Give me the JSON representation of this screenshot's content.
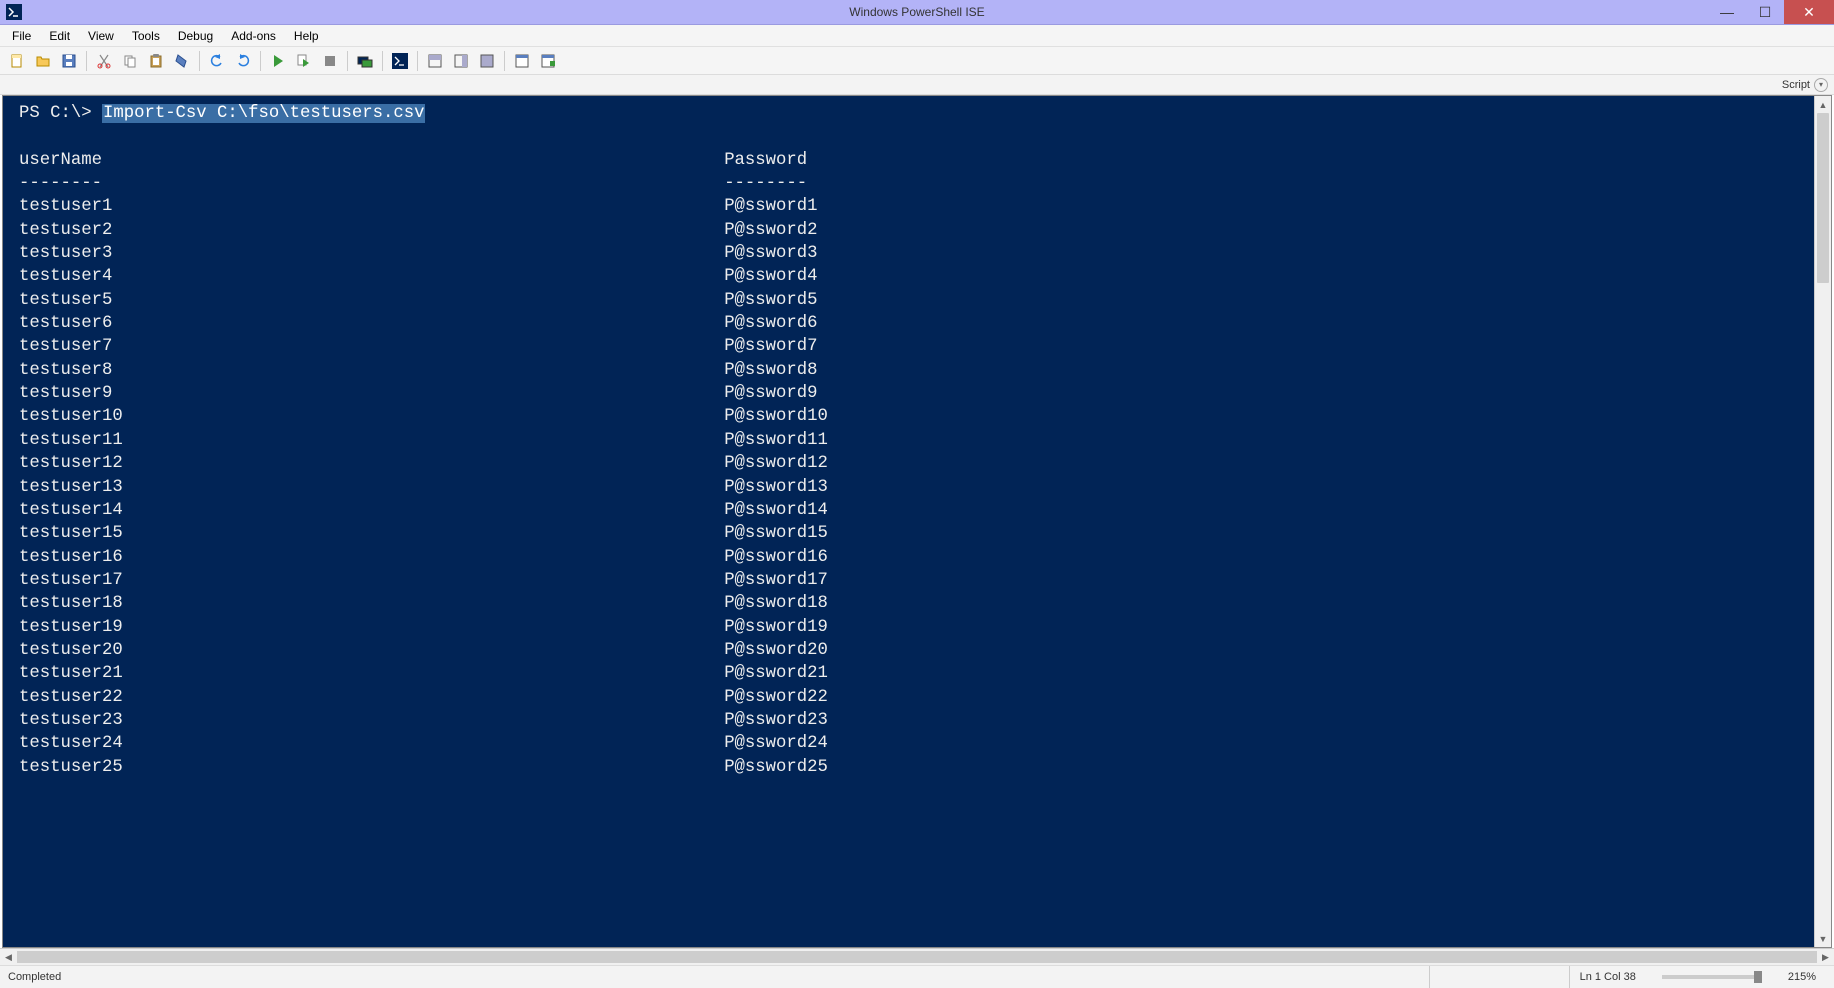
{
  "window": {
    "title": "Windows PowerShell ISE"
  },
  "menu": {
    "items": [
      "File",
      "Edit",
      "View",
      "Tools",
      "Debug",
      "Add-ons",
      "Help"
    ]
  },
  "scriptbar": {
    "label": "Script"
  },
  "console": {
    "prompt": "PS C:\\> ",
    "command": "Import-Csv C:\\fso\\testusers.csv",
    "headers": {
      "col1": "userName",
      "col2": "Password"
    },
    "divider": "--------",
    "rows": [
      {
        "user": "testuser1",
        "pass": "P@ssword1"
      },
      {
        "user": "testuser2",
        "pass": "P@ssword2"
      },
      {
        "user": "testuser3",
        "pass": "P@ssword3"
      },
      {
        "user": "testuser4",
        "pass": "P@ssword4"
      },
      {
        "user": "testuser5",
        "pass": "P@ssword5"
      },
      {
        "user": "testuser6",
        "pass": "P@ssword6"
      },
      {
        "user": "testuser7",
        "pass": "P@ssword7"
      },
      {
        "user": "testuser8",
        "pass": "P@ssword8"
      },
      {
        "user": "testuser9",
        "pass": "P@ssword9"
      },
      {
        "user": "testuser10",
        "pass": "P@ssword10"
      },
      {
        "user": "testuser11",
        "pass": "P@ssword11"
      },
      {
        "user": "testuser12",
        "pass": "P@ssword12"
      },
      {
        "user": "testuser13",
        "pass": "P@ssword13"
      },
      {
        "user": "testuser14",
        "pass": "P@ssword14"
      },
      {
        "user": "testuser15",
        "pass": "P@ssword15"
      },
      {
        "user": "testuser16",
        "pass": "P@ssword16"
      },
      {
        "user": "testuser17",
        "pass": "P@ssword17"
      },
      {
        "user": "testuser18",
        "pass": "P@ssword18"
      },
      {
        "user": "testuser19",
        "pass": "P@ssword19"
      },
      {
        "user": "testuser20",
        "pass": "P@ssword20"
      },
      {
        "user": "testuser21",
        "pass": "P@ssword21"
      },
      {
        "user": "testuser22",
        "pass": "P@ssword22"
      },
      {
        "user": "testuser23",
        "pass": "P@ssword23"
      },
      {
        "user": "testuser24",
        "pass": "P@ssword24"
      },
      {
        "user": "testuser25",
        "pass": "P@ssword25"
      }
    ]
  },
  "status": {
    "left": "Completed",
    "lncol": "Ln 1  Col 38",
    "zoom": "215%"
  },
  "toolbar_icons": [
    "new-file-icon",
    "open-file-icon",
    "save-icon",
    "cut-icon",
    "copy-icon",
    "paste-icon",
    "clear-icon",
    "undo-icon",
    "redo-icon",
    "run-icon",
    "run-selection-icon",
    "stop-icon",
    "remote-icon",
    "powershell-icon",
    "show-script-top-icon",
    "show-script-right-icon",
    "show-script-max-icon",
    "show-command-icon",
    "show-command-addon-icon"
  ]
}
